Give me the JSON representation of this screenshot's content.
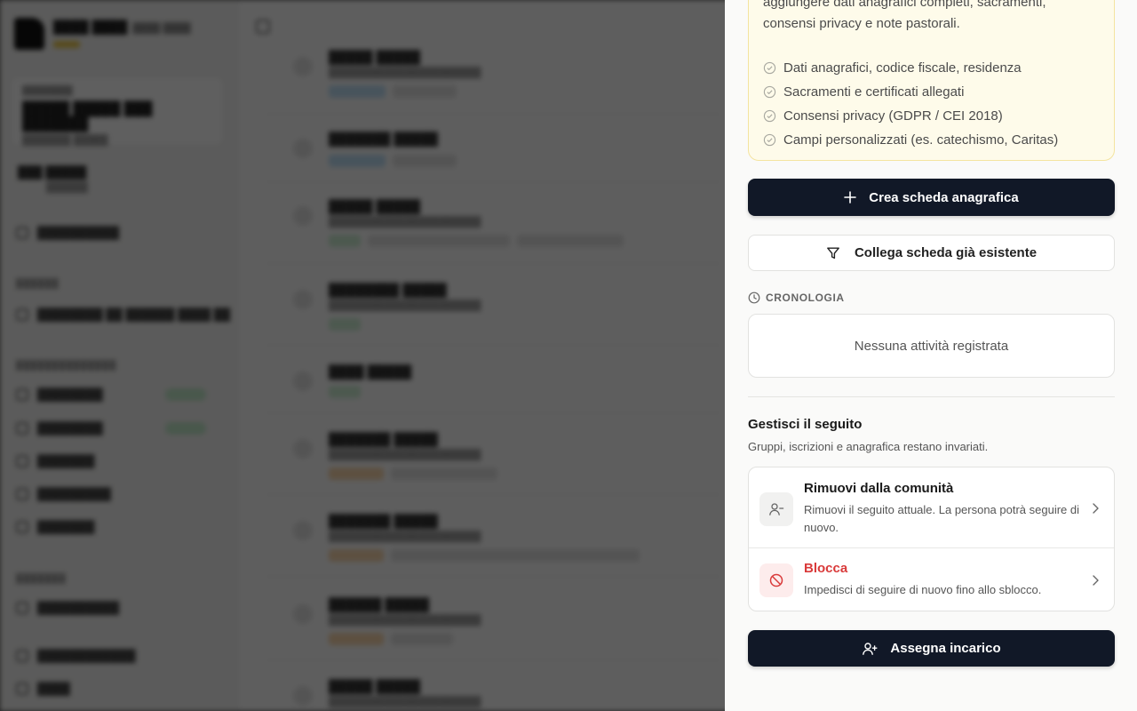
{
  "info": {
    "description": "aggiungere dati anagrafici completi, sacramenti, consensi privacy e note pastorali.",
    "features": [
      "Dati anagrafici, codice fiscale, residenza",
      "Sacramenti e certificati allegati",
      "Consensi privacy (GDPR / CEI 2018)",
      "Campi personalizzati (es. catechismo, Caritas)"
    ]
  },
  "buttons": {
    "create": "Crea scheda anagrafica",
    "link": "Collega scheda già esistente",
    "assign": "Assegna incarico"
  },
  "history": {
    "label": "CRONOLOGIA",
    "empty": "Nessuna attività registrata"
  },
  "manage": {
    "title": "Gestisci il seguito",
    "subtitle": "Gruppi, iscrizioni e anagrafica restano invariati.",
    "remove": {
      "title": "Rimuovi dalla comunità",
      "desc": "Rimuovi il seguito attuale. La persona potrà seguire di nuovo."
    },
    "block": {
      "title": "Blocca",
      "desc": "Impedisci di seguire di nuovo fino allo sblocco."
    }
  },
  "colors": {
    "primary": "#111827",
    "danger": "#d93a3a",
    "info_bg": "#fefbea",
    "info_border": "#f4e4a0"
  }
}
